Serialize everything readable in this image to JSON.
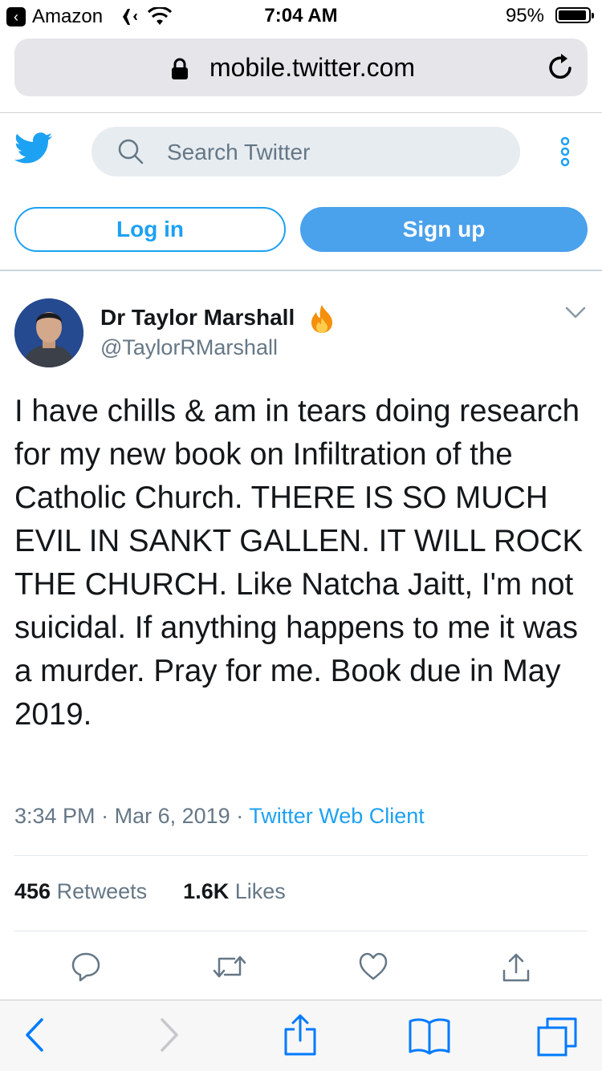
{
  "status_bar": {
    "back_app": "Amazon",
    "time": "7:04 AM",
    "battery": "95%"
  },
  "browser": {
    "url": "mobile.twitter.com"
  },
  "header": {
    "search_placeholder": "Search Twitter",
    "login_label": "Log in",
    "signup_label": "Sign up"
  },
  "tweet": {
    "author_name": "Dr Taylor Marshall",
    "author_handle": "@TaylorRMarshall",
    "text": "I have chills & am in tears doing research for my new book on Infiltration of the Catholic Church. THERE IS SO MUCH EVIL IN SANKT GALLEN. IT WILL ROCK THE CHURCH. Like Natcha Jaitt, I'm not suicidal. If anything happens to me it was a murder. Pray for me. Book due in May 2019.",
    "time": "3:34 PM",
    "date": "Mar 6, 2019",
    "source": "Twitter Web Client",
    "retweet_count": "456",
    "retweet_label": "Retweets",
    "like_count": "1.6K",
    "like_label": "Likes"
  },
  "icons": {
    "twitter_bird": "twitter-bird-icon",
    "search": "search-icon",
    "more": "more-vertical-icon",
    "fire": "fire-emoji-icon",
    "caret": "chevron-down-icon",
    "reply": "reply-icon",
    "retweet": "retweet-icon",
    "like": "heart-icon",
    "share": "share-icon"
  },
  "colors": {
    "twitter_blue": "#1da1f2",
    "signup_fill": "#4aa1ec",
    "ios_blue": "#007aff",
    "muted_text": "#657786"
  }
}
